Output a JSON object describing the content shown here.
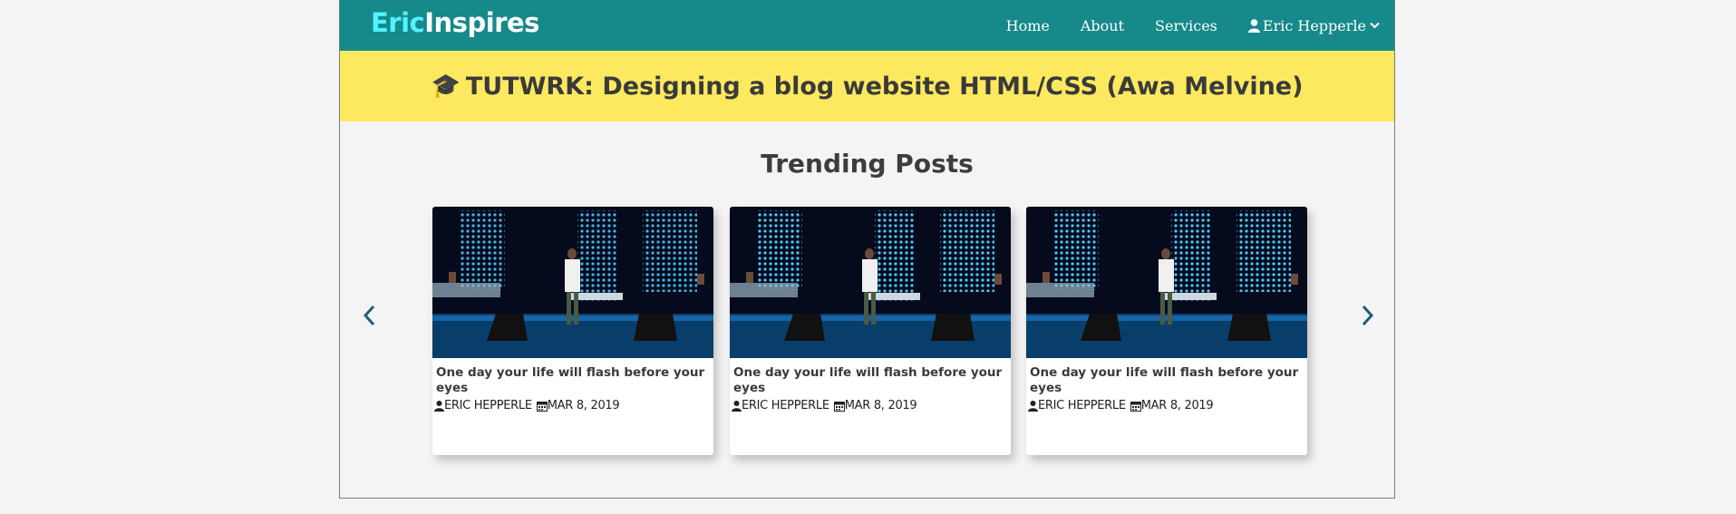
{
  "brand": {
    "part1": "Eric",
    "part2": "Inspires",
    "accent": "#52f2ff"
  },
  "nav": {
    "items": [
      "Home",
      "About",
      "Services"
    ],
    "user_name": "Eric Hepperle",
    "user_icon": "user-icon",
    "dropdown_icon": "chevron-down-icon"
  },
  "banner": {
    "icon": "🎓",
    "title": "TUTWRK: Designing a blog website HTML/CSS (Awa Melvine)"
  },
  "trending": {
    "title": "Trending Posts",
    "posts": [
      {
        "title": "One day your life will flash before your eyes",
        "author": "ERIC HEPPERLE",
        "date": "MAR 8, 2019"
      },
      {
        "title": "One day your life will flash before your eyes",
        "author": "ERIC HEPPERLE",
        "date": "MAR 8, 2019"
      },
      {
        "title": "One day your life will flash before your eyes",
        "author": "ERIC HEPPERLE",
        "date": "MAR 8, 2019"
      }
    ]
  },
  "colors": {
    "navbar": "#16898a",
    "banner": "#fde95f",
    "arrow": "#1d6074"
  }
}
